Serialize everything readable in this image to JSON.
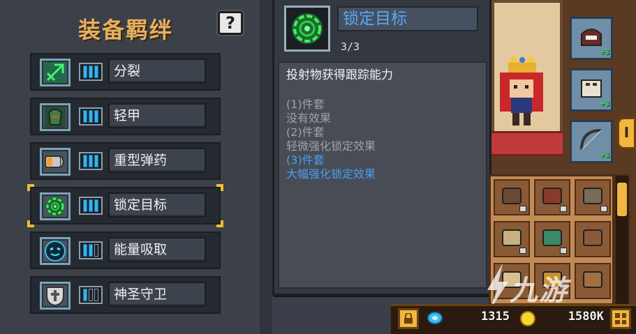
{
  "left_panel": {
    "title": "装备羁绊",
    "help_label": "?",
    "sets": [
      {
        "name": "分裂",
        "icon": "split-arrows-icon",
        "bars_filled": 3,
        "bars_total": 3,
        "selected": false
      },
      {
        "name": "轻甲",
        "icon": "light-armor-icon",
        "bars_filled": 3,
        "bars_total": 3,
        "selected": false
      },
      {
        "name": "重型弹药",
        "icon": "heavy-ammo-icon",
        "bars_filled": 3,
        "bars_total": 3,
        "selected": false
      },
      {
        "name": "锁定目标",
        "icon": "target-lock-icon",
        "bars_filled": 3,
        "bars_total": 3,
        "selected": true
      },
      {
        "name": "能量吸取",
        "icon": "energy-drain-icon",
        "bars_filled": 2,
        "bars_total": 3,
        "selected": false
      },
      {
        "name": "神圣守卫",
        "icon": "holy-shield-icon",
        "bars_filled": 1,
        "bars_total": 3,
        "selected": false
      }
    ]
  },
  "tooltip": {
    "icon": "target-lock-icon",
    "title": "锁定目标",
    "count": "3/3",
    "description": "投射物获得跟踪能力",
    "tiers": [
      {
        "label": "(1)件套",
        "effect": "没有效果",
        "active": false
      },
      {
        "label": "(2)件套",
        "effect": "轻微强化锁定效果",
        "active": false
      },
      {
        "label": "(3)件套",
        "effect": "大幅强化锁定效果",
        "active": true
      }
    ]
  },
  "equipment": {
    "slots": [
      {
        "icon": "helmet-icon",
        "badge": "+3"
      },
      {
        "icon": "chest-armor-icon",
        "badge": "+3"
      },
      {
        "icon": "bow-icon",
        "badge": "+3"
      }
    ],
    "side_tab": "I"
  },
  "inventory": {
    "items": [
      {
        "icon": "boots-icon",
        "locked": true
      },
      {
        "icon": "gauntlet-icon",
        "locked": true
      },
      {
        "icon": "coil-icon",
        "locked": true
      },
      {
        "icon": "crossed-swords-icon",
        "locked": true
      },
      {
        "icon": "belt-armor-icon",
        "locked": true
      },
      {
        "icon": "swirl-icon",
        "locked": false
      },
      {
        "icon": "scroll-icon",
        "locked": false
      },
      {
        "icon": "chest-icon",
        "locked": false
      },
      {
        "icon": "sword-icon",
        "locked": false
      }
    ]
  },
  "currency": {
    "gems": "1315",
    "coins": "1580K"
  },
  "watermark": "九游",
  "colors": {
    "gold_title": "#e6b062",
    "bar_blue": "#35b4ef",
    "tooltip_title_blue": "#5aa8f2",
    "active_tier_blue": "#4a9ef5",
    "selected_corner": "#f2bd32"
  }
}
